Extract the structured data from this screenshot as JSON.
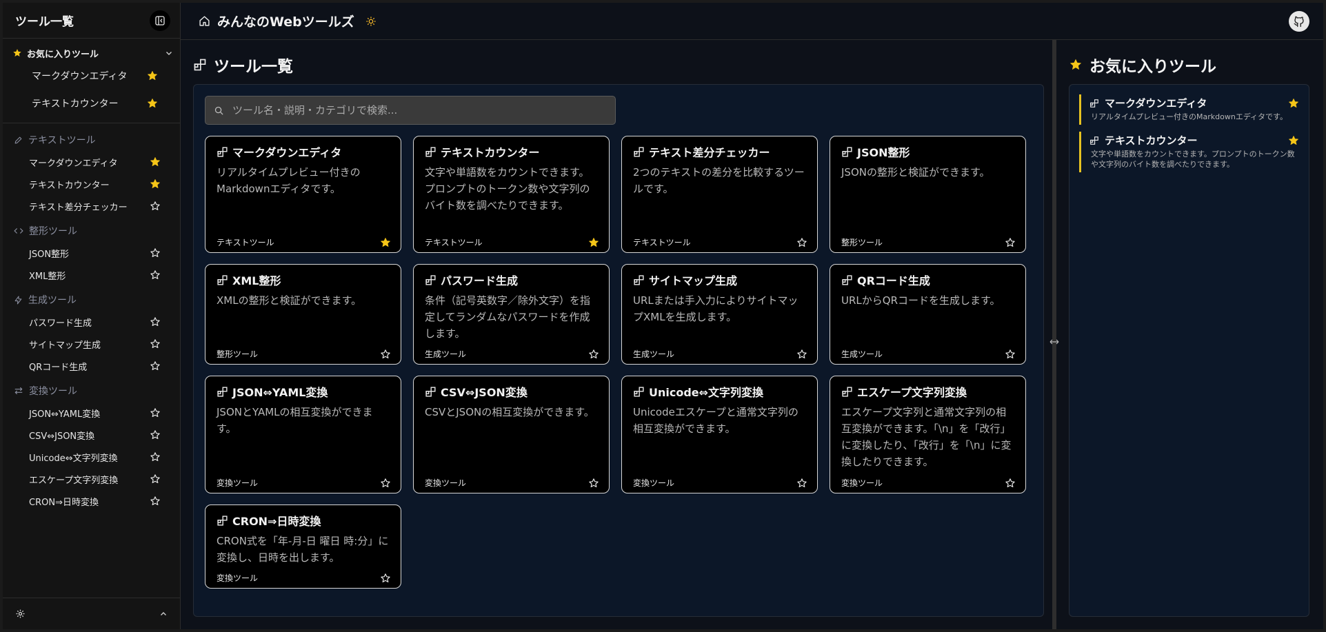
{
  "sidebar": {
    "title": "ツール一覧",
    "favorites_header": "お気に入りツール",
    "favorites": [
      {
        "label": "マークダウンエディタ",
        "favorited": true
      },
      {
        "label": "テキストカウンター",
        "favorited": true
      }
    ],
    "categories": [
      {
        "label": "テキストツール",
        "icon": "pencil-icon",
        "items": [
          {
            "label": "マークダウンエディタ",
            "favorited": true
          },
          {
            "label": "テキストカウンター",
            "favorited": true
          },
          {
            "label": "テキスト差分チェッカー",
            "favorited": false
          }
        ]
      },
      {
        "label": "整形ツール",
        "icon": "code-icon",
        "items": [
          {
            "label": "JSON整形",
            "favorited": false
          },
          {
            "label": "XML整形",
            "favorited": false
          }
        ]
      },
      {
        "label": "生成ツール",
        "icon": "bolt-icon",
        "items": [
          {
            "label": "パスワード生成",
            "favorited": false
          },
          {
            "label": "サイトマップ生成",
            "favorited": false
          },
          {
            "label": "QRコード生成",
            "favorited": false
          }
        ]
      },
      {
        "label": "変換ツール",
        "icon": "swap-icon",
        "items": [
          {
            "label": "JSON⇔YAML変換",
            "favorited": false
          },
          {
            "label": "CSV⇔JSON変換",
            "favorited": false
          },
          {
            "label": "Unicode⇔文字列変換",
            "favorited": false
          },
          {
            "label": "エスケープ文字列変換",
            "favorited": false
          },
          {
            "label": "CRON⇒日時変換",
            "favorited": false
          }
        ]
      }
    ]
  },
  "header": {
    "app_title": "みんなのWebツールズ"
  },
  "tools": {
    "title": "ツール一覧",
    "search_placeholder": "ツール名・説明・カテゴリで検索...",
    "cards": [
      {
        "title": "マークダウンエディタ",
        "desc": "リアルタイムプレビュー付きのMarkdownエディタです。",
        "category": "テキストツール",
        "favorited": true
      },
      {
        "title": "テキストカウンター",
        "desc": "文字や単語数をカウントできます。プロンプトのトークン数や文字列のバイト数を調べたりできます。",
        "category": "テキストツール",
        "favorited": true
      },
      {
        "title": "テキスト差分チェッカー",
        "desc": "2つのテキストの差分を比較するツールです。",
        "category": "テキストツール",
        "favorited": false
      },
      {
        "title": "JSON整形",
        "desc": "JSONの整形と検証ができます。",
        "category": "整形ツール",
        "favorited": false
      },
      {
        "title": "XML整形",
        "desc": "XMLの整形と検証ができます。",
        "category": "整形ツール",
        "favorited": false
      },
      {
        "title": "パスワード生成",
        "desc": "条件（記号英数字／除外文字）を指定してランダムなパスワードを作成します。",
        "category": "生成ツール",
        "favorited": false
      },
      {
        "title": "サイトマップ生成",
        "desc": "URLまたは手入力によりサイトマップXMLを生成します。",
        "category": "生成ツール",
        "favorited": false
      },
      {
        "title": "QRコード生成",
        "desc": "URLからQRコードを生成します。",
        "category": "生成ツール",
        "favorited": false
      },
      {
        "title": "JSON⇔YAML変換",
        "desc": "JSONとYAMLの相互変換ができます。",
        "category": "変換ツール",
        "favorited": false
      },
      {
        "title": "CSV⇔JSON変換",
        "desc": "CSVとJSONの相互変換ができます。",
        "category": "変換ツール",
        "favorited": false
      },
      {
        "title": "Unicode⇔文字列変換",
        "desc": "Unicodeエスケープと通常文字列の相互変換ができます。",
        "category": "変換ツール",
        "favorited": false
      },
      {
        "title": "エスケープ文字列変換",
        "desc": "エスケープ文字列と通常文字列の相互変換ができます。「\\n」を「改行」に変換したり、「改行」を「\\n」に変換したりできます。",
        "category": "変換ツール",
        "favorited": false
      },
      {
        "title": "CRON⇒日時変換",
        "desc": "CRON式を「年-月-日 曜日 時:分」に変換し、日時を出します。",
        "category": "変換ツール",
        "favorited": false
      }
    ]
  },
  "favorites_panel": {
    "title": "お気に入りツール",
    "entries": [
      {
        "title": "マークダウンエディタ",
        "desc": "リアルタイムプレビュー付きのMarkdownエディタです。"
      },
      {
        "title": "テキストカウンター",
        "desc": "文字や単語数をカウントできます。プロンプトのトークン数や文字列のバイト数を調べたりできます。"
      }
    ]
  },
  "colors": {
    "star_active": "#f5c518",
    "star_outline": "#e8e8e8",
    "fav_accent": "#e6c221"
  }
}
